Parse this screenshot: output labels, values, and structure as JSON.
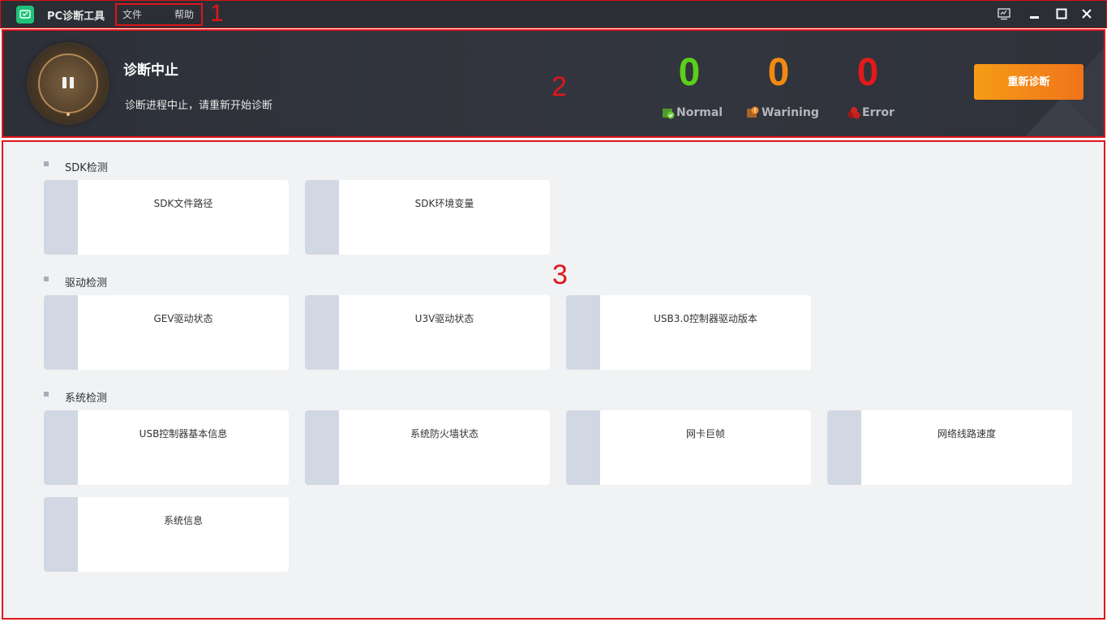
{
  "titlebar": {
    "app_title": "PC诊断工具",
    "menu": [
      "文件",
      "帮助"
    ],
    "annotation": "1"
  },
  "status": {
    "title": "诊断中止",
    "description": "诊断进程中止，请重新开始诊断",
    "annotation": "2",
    "counts": {
      "normal": {
        "value": "0",
        "label": "Normal",
        "color": "#5bd01b"
      },
      "warning": {
        "value": "0",
        "label": "Warining",
        "color": "#f18a12"
      },
      "error": {
        "value": "0",
        "label": "Error",
        "color": "#e11a1a"
      }
    },
    "restart_label": "重新诊断"
  },
  "main": {
    "annotation": "3",
    "sections": [
      {
        "title": "SDK检测",
        "items": [
          "SDK文件路径",
          "SDK环境变量"
        ]
      },
      {
        "title": "驱动检测",
        "items": [
          "GEV驱动状态",
          "U3V驱动状态",
          "USB3.0控制器驱动版本"
        ]
      },
      {
        "title": "系统检测",
        "items": [
          "USB控制器基本信息",
          "系统防火墙状态",
          "网卡巨帧",
          "网络线路速度",
          "系统信息"
        ]
      }
    ]
  },
  "colors": {
    "accent": "#1fc27a",
    "button": "#f59c16",
    "annotation": "#e0151b"
  }
}
